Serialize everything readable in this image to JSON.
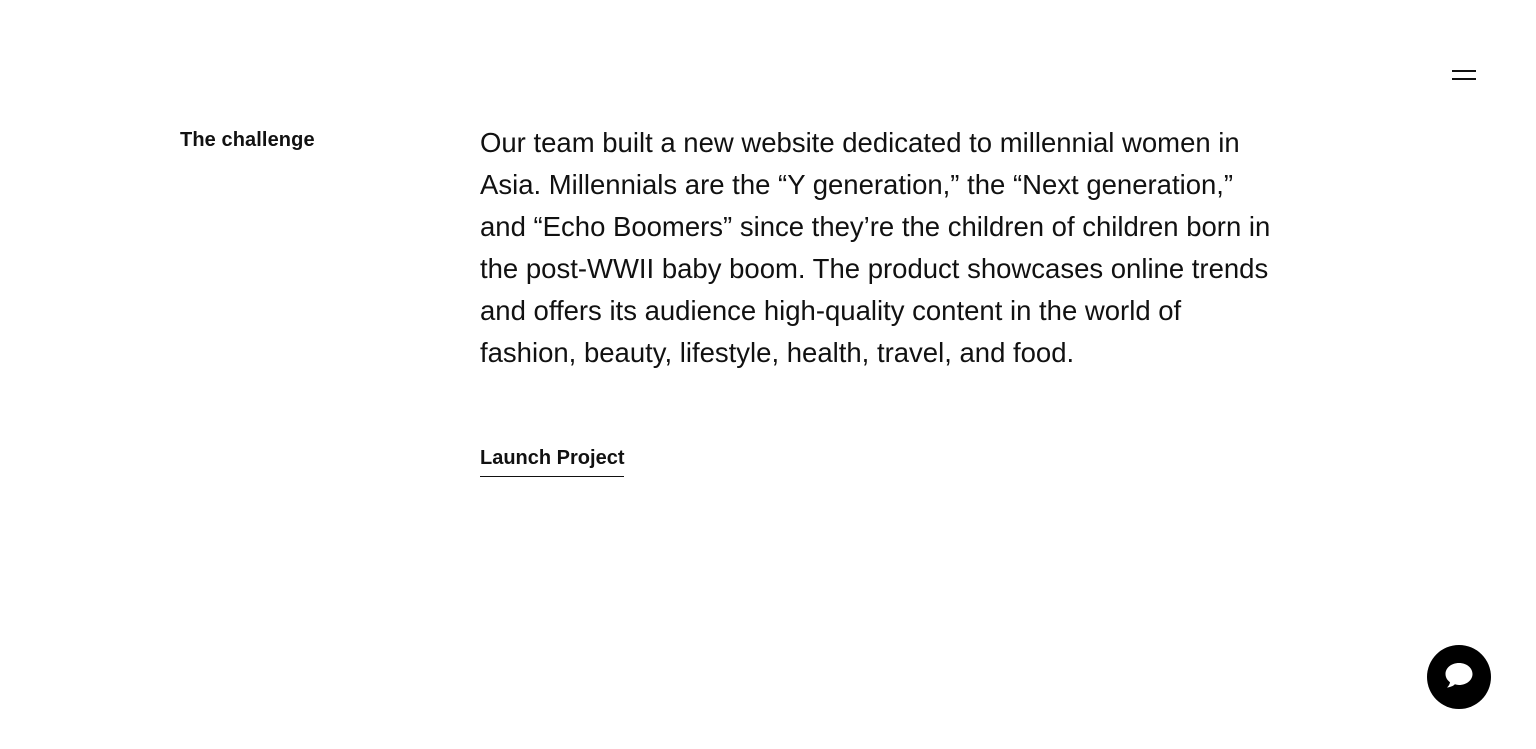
{
  "header": {
    "menu_icon": "hamburger-menu-icon"
  },
  "challenge": {
    "label": "The challenge",
    "body": "Our team built a new website dedicated to millennial women in Asia. Millennials are the “Y generation,” the “Next generation,” and “Echo Boomers” since they’re the children of children born in the post-WWII baby boom. The product showcases online trends and offers its audience high-quality content in the world of fashion, beauty, lifestyle, health, travel, and food.",
    "launch_label": "Launch Project"
  },
  "chat": {
    "icon": "chat-bubble-icon"
  },
  "colors": {
    "text": "#111111",
    "background": "#ffffff",
    "chat_button": "#000000"
  }
}
